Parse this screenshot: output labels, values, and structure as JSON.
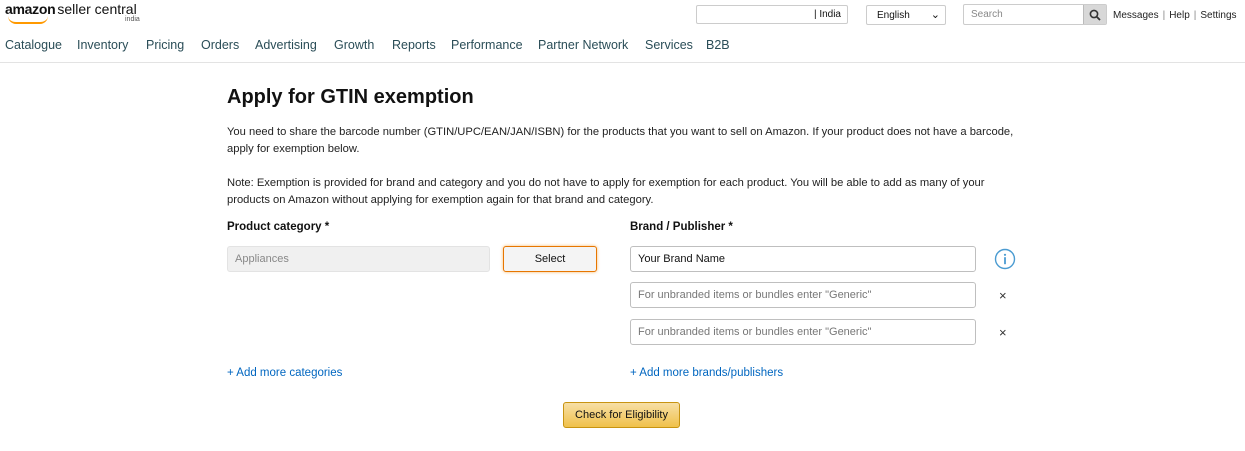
{
  "header": {
    "logo_text": "amazon",
    "logo_suffix": "seller central",
    "logo_region": "india",
    "marketplace": "| India",
    "language": "English",
    "search_placeholder": "Search",
    "links": [
      "Messages",
      "Help",
      "Settings"
    ]
  },
  "nav": [
    "Catalogue",
    "Inventory",
    "Pricing",
    "Orders",
    "Advertising",
    "Growth",
    "Reports",
    "Performance",
    "Partner Network",
    "Services",
    "B2B"
  ],
  "main": {
    "title": "Apply for GTIN exemption",
    "intro": "You need to share the barcode number (GTIN/UPC/EAN/JAN/ISBN) for the products that you want to sell on Amazon. If your product does not have a barcode, apply for exemption below.",
    "note": "Note: Exemption is provided for brand and category and you do not have to apply for exemption for each product. You will be able to add as many of your products on Amazon without applying for exemption again for that brand and category.",
    "category_label": "Product category *",
    "category_value": "Appliances",
    "select_label": "Select",
    "brand_label": "Brand / Publisher *",
    "brand_value": "Your Brand Name",
    "brand_placeholder_1": "For unbranded items or bundles enter \"Generic\"",
    "brand_placeholder_2": "For unbranded items or bundles enter \"Generic\"",
    "add_categories": "+ Add more categories",
    "add_brands": "+ Add more brands/publishers",
    "check_button": "Check for Eligibility"
  },
  "colors": {
    "nav_text": "#2a4d57",
    "link": "#0066c0",
    "primary_button": "#f0c14b",
    "focus_border": "#e77600",
    "info_icon": "#4a9bd1"
  }
}
